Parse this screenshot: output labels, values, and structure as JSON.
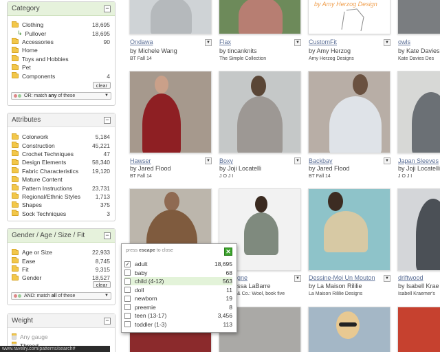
{
  "category": {
    "title": "Category",
    "items": [
      {
        "label": "Clothing",
        "count": "18,695"
      },
      {
        "label": "Pullover",
        "count": "18,695"
      },
      {
        "label": "Accessories",
        "count": "90"
      },
      {
        "label": "Home",
        "count": ""
      },
      {
        "label": "Toys and Hobbies",
        "count": ""
      },
      {
        "label": "Pet",
        "count": ""
      },
      {
        "label": "Components",
        "count": "4"
      }
    ],
    "clear": "clear",
    "match_prefix": "OR: match ",
    "match_word": "any",
    "match_suffix": " of these"
  },
  "attributes": {
    "title": "Attributes",
    "items": [
      {
        "label": "Colorwork",
        "count": "5,184"
      },
      {
        "label": "Construction",
        "count": "45,221"
      },
      {
        "label": "Crochet Techniques",
        "count": "47"
      },
      {
        "label": "Design Elements",
        "count": "58,340"
      },
      {
        "label": "Fabric Characteristics",
        "count": "19,120"
      },
      {
        "label": "Mature Content",
        "count": ""
      },
      {
        "label": "Pattern Instructions",
        "count": "23,731"
      },
      {
        "label": "Regional/Ethnic Styles",
        "count": "1,713"
      },
      {
        "label": "Shapes",
        "count": "375"
      },
      {
        "label": "Sock Techniques",
        "count": "3"
      }
    ]
  },
  "gender": {
    "title": "Gender / Age / Size / Fit",
    "items": [
      {
        "label": "Age or Size",
        "count": "22,933"
      },
      {
        "label": "Ease",
        "count": "8,745"
      },
      {
        "label": "Fit",
        "count": "9,315"
      },
      {
        "label": "Gender",
        "count": "18,527"
      }
    ],
    "clear": "clear",
    "match_prefix": "AND: match ",
    "match_word": "all",
    "match_suffix": " of these"
  },
  "weight": {
    "title": "Weight",
    "items": [
      {
        "label": "Any gauge"
      },
      {
        "label": "Thread"
      }
    ]
  },
  "popup": {
    "hint_prefix": "press ",
    "hint_key": "escape",
    "hint_suffix": " to close",
    "close": "✕",
    "options": [
      {
        "label": "adult",
        "count": "18,695",
        "checked": true
      },
      {
        "label": "baby",
        "count": "68"
      },
      {
        "label": "child (4-12)",
        "count": "563"
      },
      {
        "label": "doll",
        "count": "11"
      },
      {
        "label": "newborn",
        "count": "19"
      },
      {
        "label": "preemie",
        "count": "8"
      },
      {
        "label": "teen (13-17)",
        "count": "3,456"
      },
      {
        "label": "toddler (1-3)",
        "count": "113"
      }
    ]
  },
  "patterns": [
    {
      "title": "Ondawa",
      "by": "by Michele Wang",
      "source": "BT Fall 14"
    },
    {
      "title": "Flax",
      "by": "by tincanknits",
      "source": "The Simple Collection"
    },
    {
      "title": "CustomFit",
      "by": "by Amy Herzog",
      "source": "Amy Herzog Designs"
    },
    {
      "title": "owls",
      "by": "by Kate Davies",
      "source": "Kate Davies Des"
    },
    {
      "title": "Hawser",
      "by": "by Jared Flood",
      "source": "BT Fall 14"
    },
    {
      "title": "Boxy",
      "by": "by Joji Locatelli",
      "source": "J O J I"
    },
    {
      "title": "Backbay",
      "by": "by Jared Flood",
      "source": "BT Fall 14"
    },
    {
      "title": "Japan Sleeves",
      "by": "by Joji Locatelli",
      "source": "J O J I"
    },
    {
      "title": "",
      "by": "",
      "source": ""
    },
    {
      "title": "gne",
      "by": "ssa LaBarre",
      "source": "& Co.: Wool, book five"
    },
    {
      "title": "Dessine-Moi Un Mouton",
      "by": "by La Maison Rililie",
      "source": "La Maison Rililie Designs"
    },
    {
      "title": "driftwood",
      "by": "by Isabell Krae",
      "source": "Isabell Kraemer's"
    }
  ],
  "logo_text": "by Amy Herzog Design",
  "status": "www.ravelry.com/patterns/search#",
  "colors": {
    "header_green": "#e6f2dc",
    "link": "#5a6e96",
    "close_green": "#3ba32b"
  }
}
